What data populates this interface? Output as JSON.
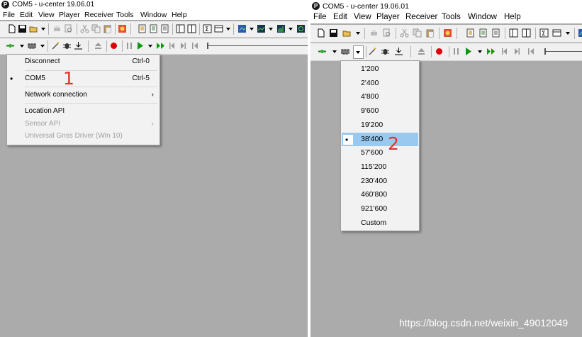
{
  "left_window": {
    "title": "COM5 - u-center 19.06.01",
    "logo_letter": "P",
    "menu": [
      "File",
      "Edit",
      "View",
      "Player",
      "Receiver",
      "Tools",
      "Window",
      "Help"
    ],
    "dropdown": {
      "items": [
        {
          "label": "Disconnect",
          "shortcut": "Ctrl-0"
        },
        {
          "label": "COM5",
          "shortcut": "Ctrl-5",
          "bullet": "•"
        },
        {
          "label": "Network connection",
          "arrow": "›"
        },
        {
          "label": "Location API"
        },
        {
          "label": "Sensor API",
          "arrow": "›",
          "disabled": true
        },
        {
          "label": "Universal Gnss Driver (Win 10)",
          "disabled": true
        }
      ]
    },
    "annotation": "1"
  },
  "right_window": {
    "title": "COM5 - u-center 19.06.01",
    "logo_letter": "P",
    "menu": [
      "File",
      "Edit",
      "View",
      "Player",
      "Receiver",
      "Tools",
      "Window",
      "Help"
    ],
    "baud_dropdown": {
      "options": [
        "1'200",
        "2'400",
        "4'800",
        "9'600",
        "19'200",
        "38'400",
        "57'600",
        "115'200",
        "230'400",
        "460'800",
        "921'600",
        "Custom"
      ],
      "selected": "38'400",
      "selected_marker": "•"
    },
    "annotation": "2"
  },
  "watermark": "https://blog.csdn.net/weixin_49012049",
  "colors": {
    "workspace": "#ababab",
    "menu_bg": "#f2f2f2",
    "selection": "#99c9ef",
    "annotation": "#e8302a",
    "record": "#e00000",
    "play": "#0a9a0a"
  }
}
